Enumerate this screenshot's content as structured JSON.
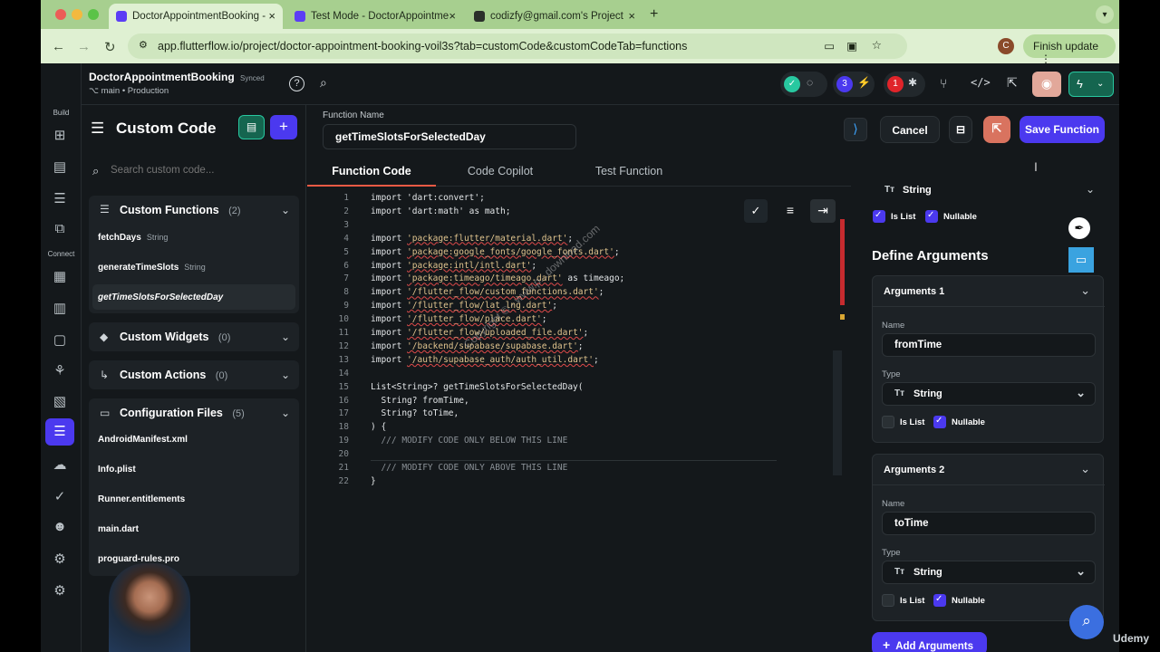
{
  "browser": {
    "tabs": [
      {
        "title": "DoctorAppointmentBooking -",
        "close": "×"
      },
      {
        "title": "Test Mode - DoctorAppointme",
        "close": "×"
      },
      {
        "title": "codizfy@gmail.com's Project",
        "close": "×"
      }
    ],
    "new_tab": "+",
    "url": "app.flutterflow.io/project/doctor-appointment-booking-voil3s?tab=customCode&customCodeTab=functions",
    "profile_letter": "C",
    "finish_update": "Finish update"
  },
  "project": {
    "name": "DoctorAppointmentBooking",
    "sync_status": "Synced",
    "branch": "main",
    "environment": "Production"
  },
  "toolbar": {
    "badge_a": "3",
    "badge_b": "1"
  },
  "rail": {
    "build_label": "Build",
    "connect_label": "Connect"
  },
  "left_panel": {
    "title": "Custom Code",
    "search_placeholder": "Search custom code...",
    "sections": [
      {
        "name": "Custom Functions",
        "count": "(2)"
      },
      {
        "name": "Custom Widgets",
        "count": "(0)"
      },
      {
        "name": "Custom Actions",
        "count": "(0)"
      },
      {
        "name": "Configuration Files",
        "count": "(5)"
      }
    ],
    "functions": [
      {
        "name": "fetchDays",
        "type": "String"
      },
      {
        "name": "generateTimeSlots",
        "type": "String"
      },
      {
        "name": "getTimeSlotsForSelectedDay",
        "type": ""
      }
    ],
    "config_files": [
      "AndroidManifest.xml",
      "Info.plist",
      "Runner.entitlements",
      "main.dart",
      "proguard-rules.pro"
    ]
  },
  "editor": {
    "function_name_label": "Function Name",
    "function_name": "getTimeSlotsForSelectedDay",
    "cancel": "Cancel",
    "save": "Save Function",
    "tabs": [
      "Function Code",
      "Code Copilot",
      "Test Function"
    ],
    "active_tab": "Function Code",
    "code_lines": [
      {
        "n": "1",
        "t": "import 'dart:convert';"
      },
      {
        "n": "2",
        "t": "import 'dart:math' as math;"
      },
      {
        "n": "3",
        "t": ""
      },
      {
        "n": "4",
        "t": "import 'package:flutter/material.dart';"
      },
      {
        "n": "5",
        "t": "import 'package:google_fonts/google_fonts.dart';"
      },
      {
        "n": "6",
        "t": "import 'package:intl/intl.dart';"
      },
      {
        "n": "7",
        "t": "import 'package:timeago/timeago.dart' as timeago;"
      },
      {
        "n": "8",
        "t": "import '/flutter_flow/custom_functions.dart';"
      },
      {
        "n": "9",
        "t": "import '/flutter_flow/lat_lng.dart';"
      },
      {
        "n": "10",
        "t": "import '/flutter_flow/place.dart';"
      },
      {
        "n": "11",
        "t": "import '/flutter_flow/uploaded_file.dart';"
      },
      {
        "n": "12",
        "t": "import '/backend/supabase/supabase.dart';"
      },
      {
        "n": "13",
        "t": "import '/auth/supabase_auth/auth_util.dart';"
      },
      {
        "n": "14",
        "t": ""
      },
      {
        "n": "15",
        "t": "List<String>? getTimeSlotsForSelectedDay("
      },
      {
        "n": "16",
        "t": "  String? fromTime,"
      },
      {
        "n": "17",
        "t": "  String? toTime,"
      },
      {
        "n": "18",
        "t": ") {"
      },
      {
        "n": "19",
        "t": "  /// MODIFY CODE ONLY BELOW THIS LINE"
      },
      {
        "n": "20",
        "t": ""
      },
      {
        "n": "21",
        "t": "  /// MODIFY CODE ONLY ABOVE THIS LINE"
      },
      {
        "n": "22",
        "t": "}"
      }
    ]
  },
  "right_panel": {
    "return_type": "String",
    "return_is_list": "Is List",
    "return_nullable": "Nullable",
    "define_arguments": "Define Arguments",
    "arguments": [
      {
        "title": "Arguments 1",
        "name_label": "Name",
        "name": "fromTime",
        "type_label": "Type",
        "type": "String",
        "is_list": "Is List",
        "nullable": "Nullable"
      },
      {
        "title": "Arguments 2",
        "name_label": "Name",
        "name": "toTime",
        "type_label": "Type",
        "type": "String",
        "is_list": "Is List",
        "nullable": "Nullable"
      }
    ],
    "add_arguments": "Add Arguments"
  },
  "watermark": {
    "text": "Copyright © - www.p...download.com",
    "udemy": "Udemy"
  }
}
